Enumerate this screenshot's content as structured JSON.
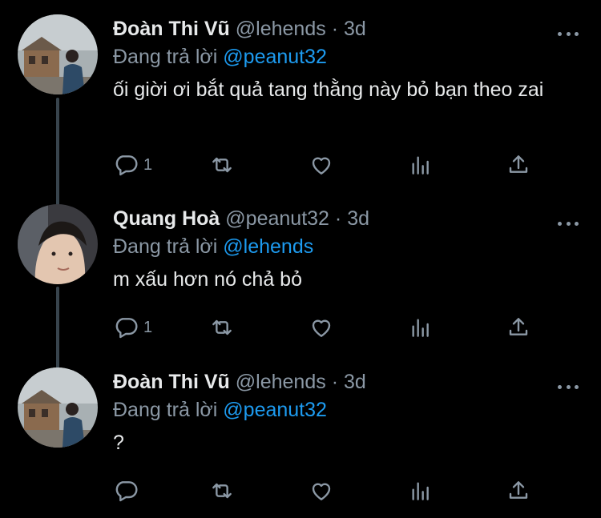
{
  "tweets": [
    {
      "name": "Đoàn Thi Vũ",
      "handle": "@lehends",
      "separator": "·",
      "time": "3d",
      "replying_prefix": "Đang trả lời ",
      "replying_to": "@peanut32",
      "text": "ối giời ơi bắt quả tang thằng này bỏ bạn theo zai",
      "reply_count": "1"
    },
    {
      "name": "Quang Hoà",
      "handle": "@peanut32",
      "separator": "·",
      "time": "3d",
      "replying_prefix": "Đang trả lời ",
      "replying_to": "@lehends",
      "text": "m xấu hơn nó chả bỏ",
      "reply_count": "1"
    },
    {
      "name": "Đoàn Thi Vũ",
      "handle": "@lehends",
      "separator": "·",
      "time": "3d",
      "replying_prefix": "Đang trả lời ",
      "replying_to": "@peanut32",
      "text": "?",
      "reply_count": ""
    }
  ],
  "colors": {
    "background": "#000000",
    "text": "#e7e9ea",
    "muted": "#8b98a5",
    "link": "#1d9bf0",
    "thread_line": "#38444d"
  },
  "icons": [
    "reply-icon",
    "retweet-icon",
    "like-icon",
    "views-icon",
    "share-icon",
    "more-icon"
  ]
}
